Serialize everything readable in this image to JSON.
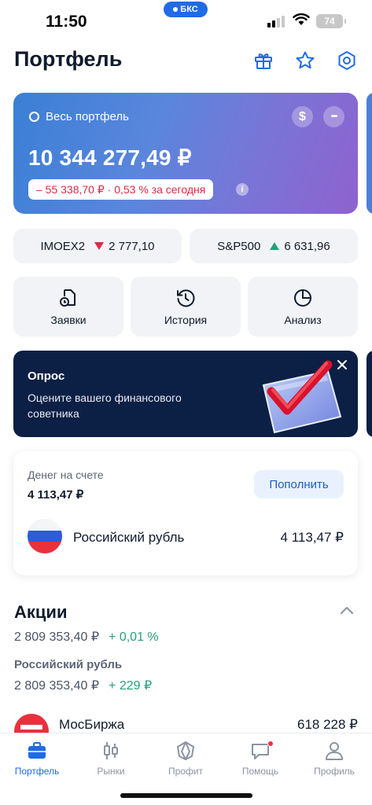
{
  "status_bar": {
    "time": "11:50",
    "island_label": "БКС",
    "battery": "74"
  },
  "header": {
    "title": "Портфель",
    "icons": [
      "gift-icon",
      "star-icon",
      "settings-hexagon-icon"
    ]
  },
  "portfolio": {
    "label": "Весь портфель",
    "currency_symbol": "$",
    "more_symbol": "•••",
    "amount": "10 344 277,49 ₽",
    "change": "– 55 338,70 ₽ · 0,53 % за сегодня",
    "info_symbol": "i"
  },
  "indices": [
    {
      "name": "IMOEX2",
      "direction": "down",
      "value": "2 777,10"
    },
    {
      "name": "S&P500",
      "direction": "up",
      "value": "6 631,96"
    }
  ],
  "actions": [
    {
      "label": "Заявки",
      "icon": "orders-icon"
    },
    {
      "label": "История",
      "icon": "history-icon"
    },
    {
      "label": "Анализ",
      "icon": "analysis-pie-icon"
    }
  ],
  "survey": {
    "title": "Опрос",
    "text": "Оцените вашего финансового советника"
  },
  "cash": {
    "label": "Денег на счете",
    "amount": "4 113,47 ₽",
    "topup_label": "Пополнить",
    "currency_name": "Российский рубль",
    "currency_value": "4 113,47 ₽"
  },
  "stocks": {
    "title": "Акции",
    "total": "2 809 353,40 ₽",
    "total_change": "+ 0,01 %",
    "group_title": "Российский рубль",
    "group_total": "2 809 353,40 ₽",
    "group_change": "+ 229 ₽",
    "items": [
      {
        "name": "МосБиржа",
        "value": "618 228 ₽"
      }
    ]
  },
  "tabs": [
    {
      "label": "Портфель",
      "active": true
    },
    {
      "label": "Рынки",
      "active": false
    },
    {
      "label": "Профит",
      "active": false
    },
    {
      "label": "Помощь",
      "active": false
    },
    {
      "label": "Профиль",
      "active": false
    }
  ],
  "colors": {
    "accent": "#1f6be6",
    "negative": "#e0294a",
    "positive": "#26a17b",
    "banner": "#0c1f45"
  }
}
